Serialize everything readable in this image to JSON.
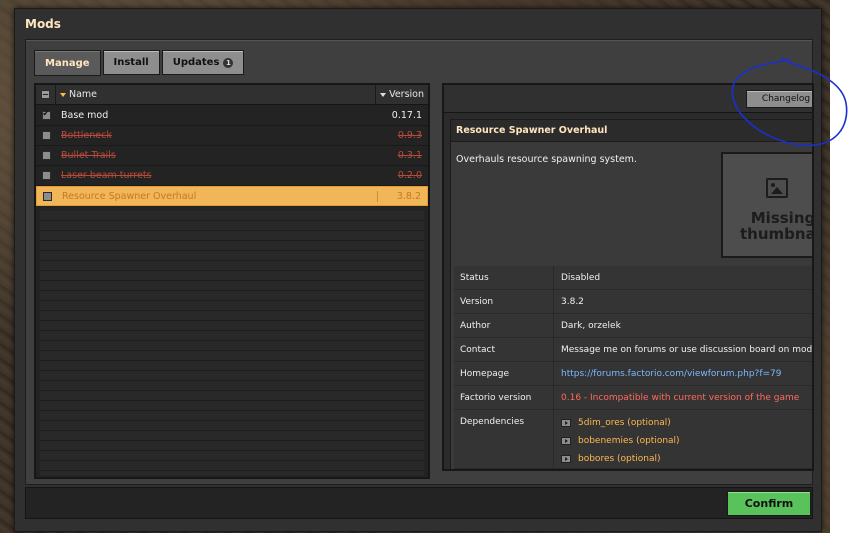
{
  "window": {
    "title": "Mods"
  },
  "tabs": [
    {
      "label": "Manage"
    },
    {
      "label": "Install"
    },
    {
      "label": "Updates",
      "badge": "1"
    }
  ],
  "mod_list": {
    "columns": {
      "name": "Name",
      "version": "Version"
    },
    "rows": [
      {
        "name": "Base mod",
        "version": "0.17.1",
        "enabled": true,
        "disabled": false,
        "selected": false
      },
      {
        "name": "Bottleneck",
        "version": "0.9.3",
        "enabled": false,
        "disabled": true,
        "selected": false
      },
      {
        "name": "Bullet Trails",
        "version": "0.3.1",
        "enabled": false,
        "disabled": true,
        "selected": false
      },
      {
        "name": "Laser beam turrets",
        "version": "0.2.0",
        "enabled": false,
        "disabled": true,
        "selected": false
      },
      {
        "name": "Resource Spawner Overhaul",
        "version": "3.8.2",
        "enabled": false,
        "disabled": false,
        "selected": true
      }
    ]
  },
  "detail": {
    "changelog_label": "Changelog",
    "title": "Resource Spawner Overhaul",
    "description": "Overhauls resource spawning system.",
    "thumbnail_text": "Missing thumbnail",
    "thumbnail_icon": "image-icon",
    "properties": {
      "status": {
        "label": "Status",
        "value": "Disabled"
      },
      "version": {
        "label": "Version",
        "value": "3.8.2"
      },
      "author": {
        "label": "Author",
        "value": "Dark, orzelek"
      },
      "contact": {
        "label": "Contact",
        "value": "Message me on forums or use discussion board on mod portal"
      },
      "homepage": {
        "label": "Homepage",
        "value": "https://forums.factorio.com/viewforum.php?f=79"
      },
      "factorio_version": {
        "label": "Factorio version",
        "value": "0.16 - Incompatible with current version of the game"
      },
      "dependencies": {
        "label": "Dependencies",
        "items": [
          "5dim_ores (optional)",
          "bobenemies (optional)",
          "bobores (optional)"
        ]
      }
    }
  },
  "footer": {
    "confirm_label": "Confirm"
  },
  "colors": {
    "selected_row": "#f1b55a",
    "confirm": "#5ac25a",
    "incompatible": "#ff6a5a",
    "link": "#7ab8ff",
    "annotation": "#1a2fd0"
  }
}
